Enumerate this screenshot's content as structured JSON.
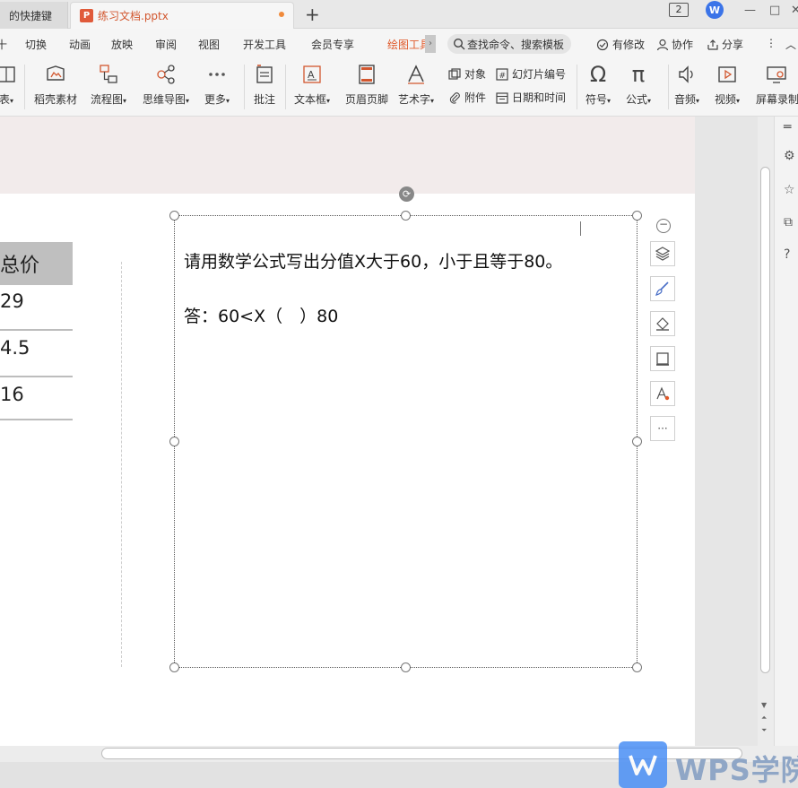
{
  "tabs": [
    {
      "label": "的快捷键"
    },
    {
      "label": "练习文档.pptx",
      "icon": "P"
    }
  ],
  "window": {
    "badge": "2",
    "brand_letter": "W",
    "minimize": "—",
    "maximize": "□",
    "close": "✕"
  },
  "menu": {
    "items": [
      "切换",
      "动画",
      "放映",
      "审阅",
      "视图",
      "开发工具",
      "会员专享",
      "绘图工具"
    ],
    "first_partial": "十",
    "more_arrow": "›",
    "search_placeholder": "查找命令、搜索模板",
    "actions": {
      "changes": "有修改",
      "collab": "协作",
      "share": "分享"
    },
    "more": "⋮",
    "collapse": "︿"
  },
  "ribbon": {
    "partial_first": "表",
    "buttons": [
      {
        "label": "稻壳素材"
      },
      {
        "label": "流程图"
      },
      {
        "label": "思维导图"
      },
      {
        "label": "更多"
      },
      {
        "label": "批注"
      },
      {
        "label": "文本框"
      },
      {
        "label": "页眉页脚"
      },
      {
        "label": "艺术字"
      },
      {
        "label": "符号"
      },
      {
        "label": "公式"
      },
      {
        "label": "音频"
      },
      {
        "label": "视频"
      },
      {
        "label": "屏幕录制"
      }
    ],
    "small": {
      "object": "对象",
      "slide_number": "幻灯片编号",
      "attachment": "附件",
      "datetime": "日期和时间"
    },
    "dropdown_marker": "▾"
  },
  "slide": {
    "table": {
      "header": "总价",
      "cells": [
        "29",
        "4.5",
        "16"
      ]
    },
    "textbox": {
      "line1": "请用数学公式写出分值X大于60，小于且等于80。",
      "line2": "答：60<X（　）80"
    }
  },
  "float_tools": {
    "more": "···"
  },
  "watermark": {
    "text": "WPS学院"
  }
}
